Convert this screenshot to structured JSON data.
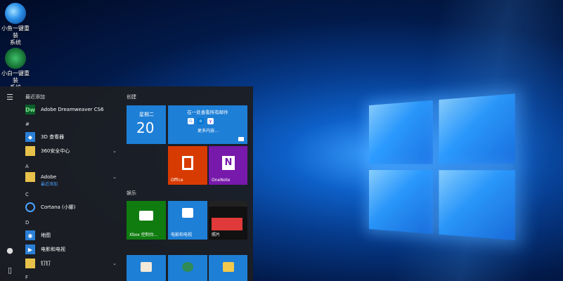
{
  "desktop": {
    "icons": [
      {
        "label_line1": "小鱼一键重装",
        "label_line2": "系统"
      },
      {
        "label_line1": "小白一键重装",
        "label_line2": "系统"
      }
    ]
  },
  "start_menu": {
    "recent_header": "最近添加",
    "recent_items": [
      {
        "label": "Adobe Dreamweaver CS6",
        "icon": "dreamweaver-icon"
      }
    ],
    "sections": [
      {
        "letter": "#",
        "items": [
          {
            "label": "3D 查看器",
            "icon": "cube-icon"
          },
          {
            "label": "360安全中心",
            "icon": "folder-icon",
            "expandable": true
          }
        ]
      },
      {
        "letter": "A",
        "items": [
          {
            "label": "Adobe",
            "sub": "最近添加",
            "icon": "folder-icon",
            "expandable": true
          }
        ]
      },
      {
        "letter": "C",
        "items": [
          {
            "label": "Cortana (小娜)",
            "icon": "cortana-icon"
          }
        ]
      },
      {
        "letter": "D",
        "items": [
          {
            "label": "地图",
            "icon": "map-icon"
          },
          {
            "label": "电影和电视",
            "icon": "film-icon"
          },
          {
            "label": "钉钉",
            "icon": "folder-icon",
            "expandable": true
          }
        ]
      },
      {
        "letter": "F",
        "items": []
      }
    ],
    "tiles": {
      "group_create": "创建",
      "calendar_day": "星期二",
      "calendar_date": "20",
      "mail_header": "在一处查看所有邮件",
      "mail_more": "更多内容...",
      "office_label": "Office",
      "onenote_label": "OneNote",
      "group_entertainment": "娱乐",
      "xbox_label": "Xbox 控制台...",
      "movies_label": "电影和电视",
      "photos_label": "照片"
    }
  },
  "colors": {
    "tile_blue": "#1e7fd6",
    "office_orange": "#d83b01",
    "onenote_purple": "#7719aa",
    "xbox_green": "#107c10"
  }
}
